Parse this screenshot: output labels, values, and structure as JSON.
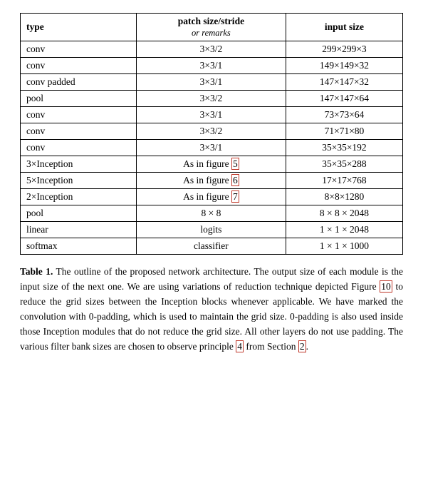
{
  "table": {
    "headers": {
      "col1": "type",
      "col2_main": "patch size/stride",
      "col2_sub": "or remarks",
      "col3": "input size"
    },
    "rows": [
      {
        "type": "conv",
        "patch": "3×3/2",
        "input": "299×299×3"
      },
      {
        "type": "conv",
        "patch": "3×3/1",
        "input": "149×149×32"
      },
      {
        "type": "conv padded",
        "patch": "3×3/1",
        "input": "147×147×32"
      },
      {
        "type": "pool",
        "patch": "3×3/2",
        "input": "147×147×64"
      },
      {
        "type": "conv",
        "patch": "3×3/1",
        "input": "73×73×64"
      },
      {
        "type": "conv",
        "patch": "3×3/2",
        "input": "71×71×80"
      },
      {
        "type": "conv",
        "patch": "3×3/1",
        "input": "35×35×192"
      },
      {
        "type": "3×Inception",
        "patch": "As in figure 5",
        "input": "35×35×288",
        "highlight_patch": true
      },
      {
        "type": "5×Inception",
        "patch": "As in figure 6",
        "input": "17×17×768",
        "highlight_patch": true
      },
      {
        "type": "2×Inception",
        "patch": "As in figure 7",
        "input": "8×8×1280",
        "highlight_patch": true
      },
      {
        "type": "pool",
        "patch": "8 × 8",
        "input": "8 × 8 × 2048"
      },
      {
        "type": "linear",
        "patch": "logits",
        "input": "1 × 1 × 2048"
      },
      {
        "type": "softmax",
        "patch": "classifier",
        "input": "1 × 1 × 1000"
      }
    ]
  },
  "caption": {
    "label": "Table 1.",
    "text": " The outline of the proposed network architecture. The output size of each module is the input size of the next one. We are using variations of reduction technique depicted Figure ",
    "ref1": "10",
    "text2": " to reduce the grid sizes between the Inception blocks whenever applicable. We have marked the convolution with 0-padding, which is used to maintain the grid size. 0-padding is also used inside those Inception modules that do not reduce the grid size. All other layers do not use padding. The various filter bank sizes are chosen to observe principle ",
    "ref2": "4",
    "text3": " from Section ",
    "ref3": "2",
    "text4": "."
  },
  "highlighted_rows": [
    0,
    1,
    2
  ],
  "figure_refs": {
    "5": "5",
    "6": "6",
    "7": "7"
  }
}
